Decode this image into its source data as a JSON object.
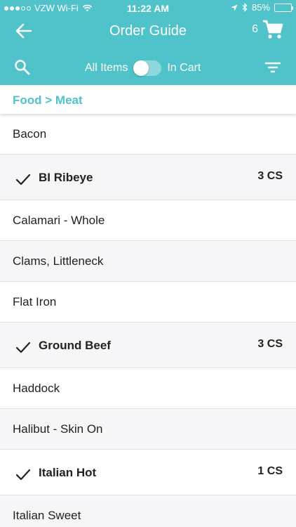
{
  "status_bar": {
    "carrier": "VZW Wi-Fi",
    "time": "11:22 AM",
    "battery": "85%",
    "battery_level": 0.85
  },
  "nav": {
    "title": "Order Guide",
    "cart_count": "6",
    "back_icon": "arrow-left-icon",
    "cart_icon": "cart-icon"
  },
  "toolbar": {
    "left_toggle_label": "All Items",
    "right_toggle_label": "In Cart",
    "toggle_on": false
  },
  "breadcrumb": "Food > Meat",
  "colors": {
    "accent": "#4fc3c9",
    "row_alt": "#f6f6f8"
  },
  "items": [
    {
      "name": "Bacon",
      "checked": false,
      "qty": ""
    },
    {
      "name": "BI Ribeye",
      "checked": true,
      "qty": "3 CS"
    },
    {
      "name": "Calamari - Whole",
      "checked": false,
      "qty": ""
    },
    {
      "name": "Clams, Littleneck",
      "checked": false,
      "qty": ""
    },
    {
      "name": "Flat Iron",
      "checked": false,
      "qty": ""
    },
    {
      "name": "Ground Beef",
      "checked": true,
      "qty": "3 CS"
    },
    {
      "name": "Haddock",
      "checked": false,
      "qty": ""
    },
    {
      "name": "Halibut - Skin On",
      "checked": false,
      "qty": ""
    },
    {
      "name": "Italian Hot",
      "checked": true,
      "qty": "1 CS"
    },
    {
      "name": "Italian Sweet",
      "checked": false,
      "qty": ""
    }
  ]
}
